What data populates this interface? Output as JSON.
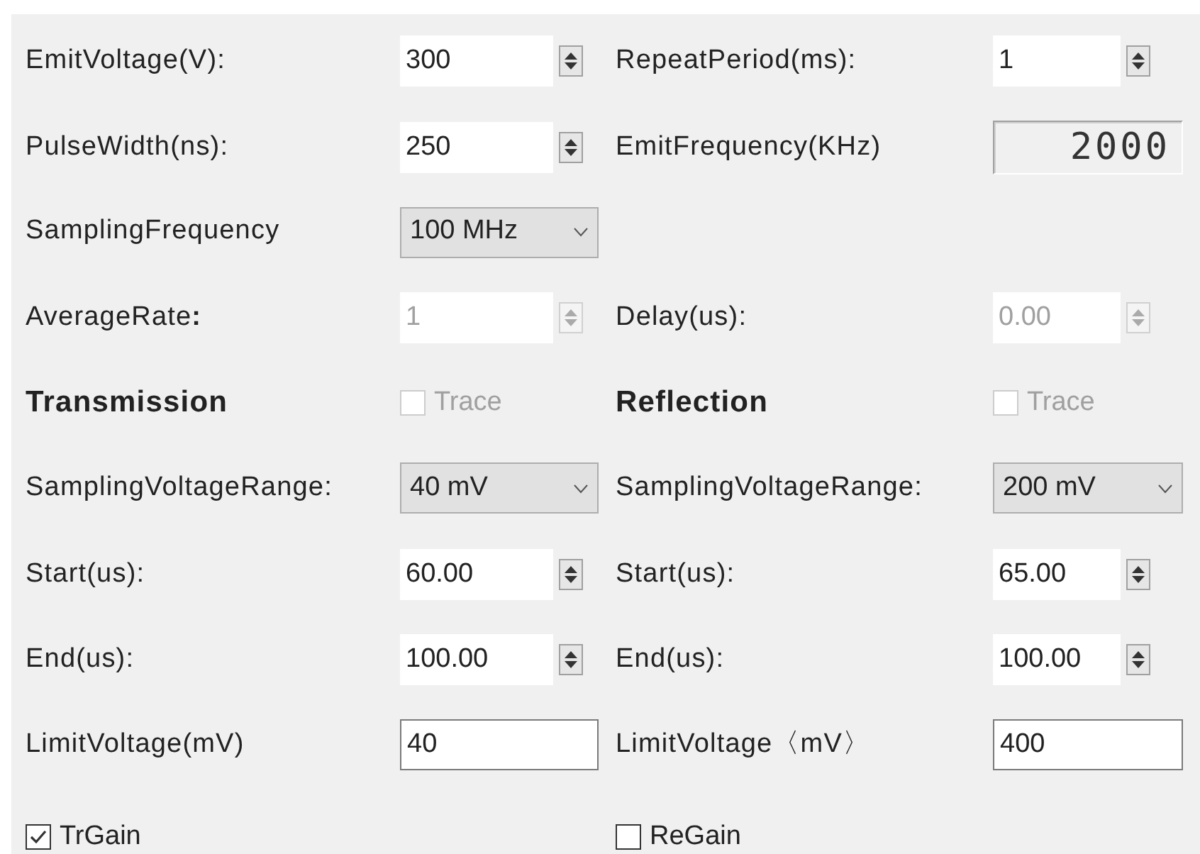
{
  "rows": [
    {
      "cells": [
        {
          "label": "EmitVoltage(V):",
          "control": {
            "kind": "spin",
            "value": "300",
            "disabled": false
          }
        },
        {
          "label": "RepeatPeriod(ms):",
          "control": {
            "kind": "spin",
            "value": "1",
            "disabled": false
          }
        }
      ]
    },
    {
      "cells": [
        {
          "label": "PulseWidth(ns):",
          "control": {
            "kind": "spin",
            "value": "250",
            "disabled": false
          }
        },
        {
          "label": "EmitFrequency(KHz)",
          "control": {
            "kind": "lcd",
            "value": "2000"
          }
        }
      ]
    },
    {
      "cells": [
        {
          "label": "SamplingFrequency",
          "control": {
            "kind": "combo",
            "value": "100 MHz"
          }
        }
      ]
    },
    {
      "cells": [
        {
          "label": "AverageRate**:**",
          "control": {
            "kind": "spin",
            "value": "1",
            "disabled": true
          }
        },
        {
          "label": "Delay(us):",
          "control": {
            "kind": "spin",
            "value": "0.00",
            "disabled": true
          }
        }
      ]
    },
    {
      "cells": [
        {
          "label": "Transmission",
          "heading": true,
          "control": {
            "kind": "checkbox",
            "text": "Trace",
            "checked": false,
            "disabled": true
          }
        },
        {
          "label": "Reflection",
          "heading": true,
          "control": {
            "kind": "checkbox",
            "text": "Trace",
            "checked": false,
            "disabled": true
          }
        }
      ]
    },
    {
      "cells": [
        {
          "label": "SamplingVoltageRange:",
          "control": {
            "kind": "combo",
            "value": "40 mV"
          }
        },
        {
          "label": "SamplingVoltageRange:",
          "control": {
            "kind": "combo",
            "value": "200 mV"
          }
        }
      ]
    },
    {
      "cells": [
        {
          "label": "Start(us):",
          "control": {
            "kind": "spin",
            "value": "60.00",
            "disabled": false
          }
        },
        {
          "label": "Start(us):",
          "control": {
            "kind": "spin",
            "value": "65.00",
            "disabled": false
          }
        }
      ]
    },
    {
      "cells": [
        {
          "label": "End(us):",
          "control": {
            "kind": "spin",
            "value": "100.00",
            "disabled": false
          }
        },
        {
          "label": "End(us):",
          "control": {
            "kind": "spin",
            "value": "100.00",
            "disabled": false
          }
        }
      ]
    },
    {
      "cells": [
        {
          "label": "LimitVoltage(mV)",
          "control": {
            "kind": "text",
            "value": "40"
          }
        },
        {
          "label": "LimitVoltage〈mV〉",
          "control": {
            "kind": "text",
            "value": "400"
          }
        }
      ]
    },
    {
      "cells": [
        {
          "control": {
            "kind": "checkbox",
            "text": "TrGain",
            "checked": true,
            "disabled": false
          }
        },
        {
          "control": {
            "kind": "checkbox",
            "text": "ReGain",
            "checked": false,
            "disabled": false
          }
        }
      ]
    }
  ]
}
